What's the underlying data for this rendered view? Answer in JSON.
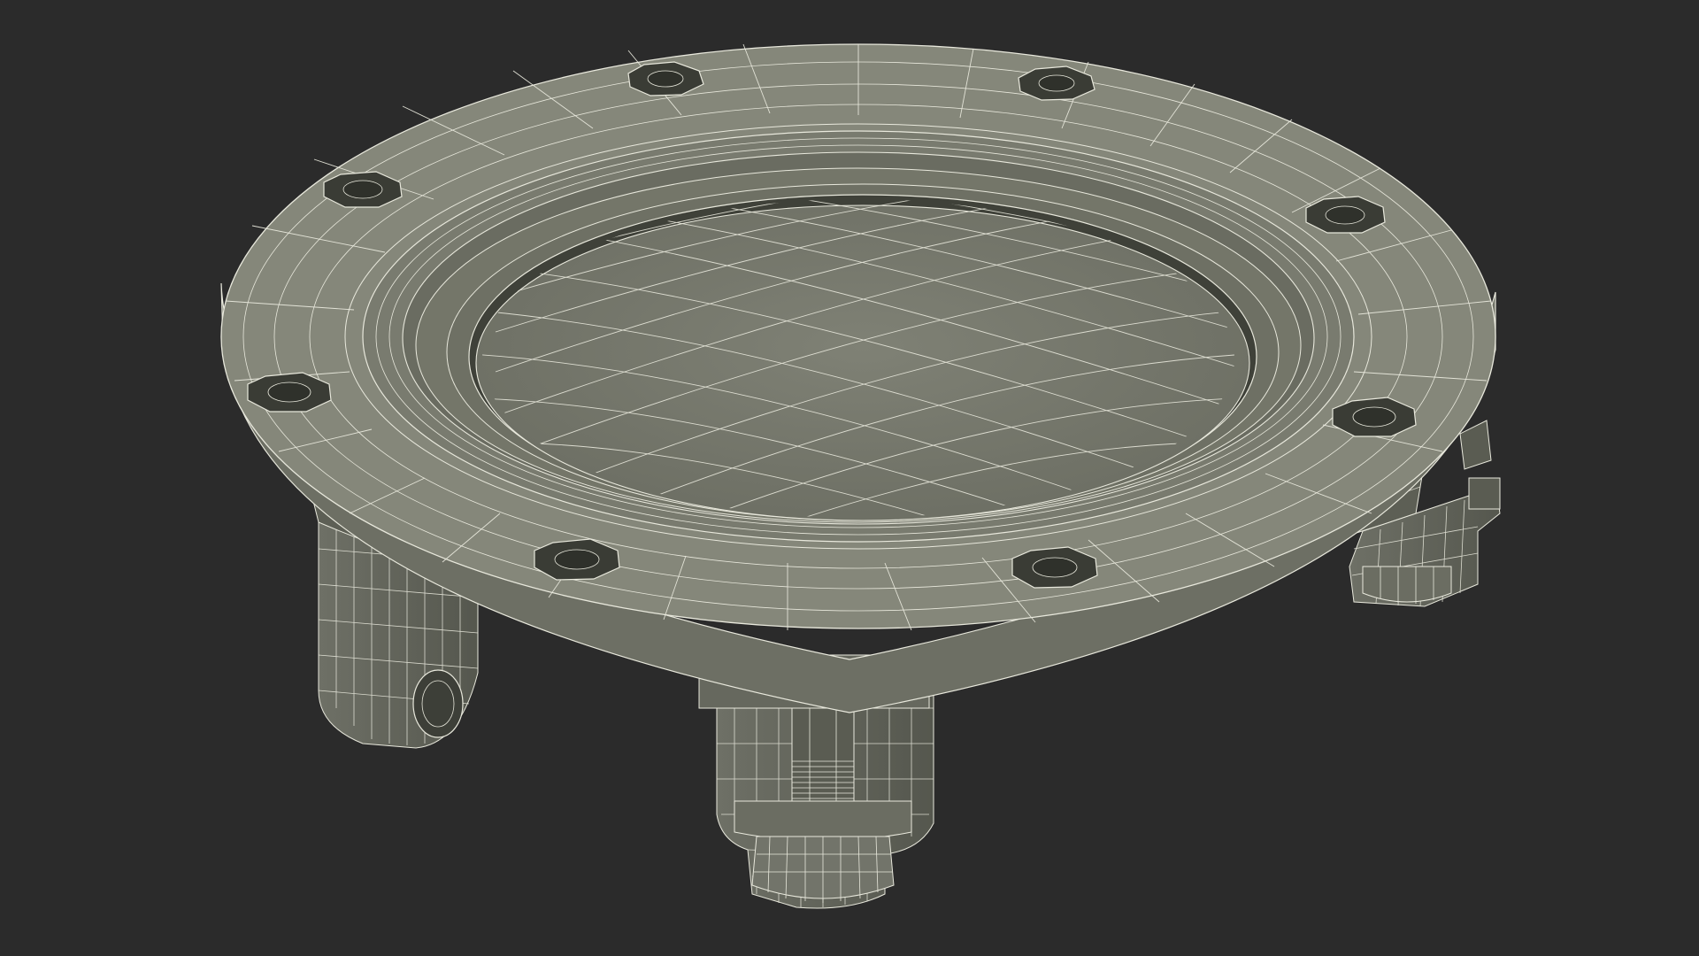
{
  "scene": {
    "subject": "wireframe-flange-model",
    "background_color": "#2b2b2b",
    "surface_color": "#85877a",
    "surface_shadow_color": "#5e6055",
    "surface_dark_color": "#4b4d44",
    "wire_color": "#e8e8dc",
    "bolt_hole_count": 8,
    "support_leg_count": 3
  }
}
